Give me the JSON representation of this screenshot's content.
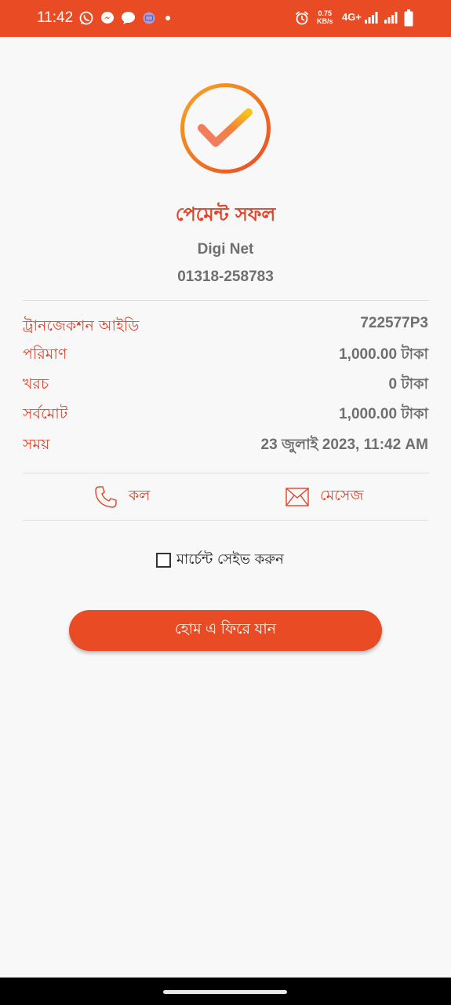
{
  "status_bar": {
    "time": "11:42",
    "net_speed_value": "0.75",
    "net_speed_unit": "KB/s",
    "network_type": "4G+",
    "background_color": "#e94b25",
    "icons": [
      "whatsapp-icon",
      "messenger-icon",
      "chat-icon",
      "app-icon",
      "dot-icon",
      "alarm-icon",
      "signal-icon",
      "signal-icon",
      "battery-icon"
    ]
  },
  "status": {
    "icon": "check-circle-icon",
    "title": "পেমেন্ট সফল"
  },
  "merchant": {
    "name": "Digi Net",
    "number": "01318-258783"
  },
  "details": [
    {
      "label": "ট্রানজেকশন আইডি",
      "value": "722577P3"
    },
    {
      "label": "পরিমাণ",
      "value": "1,000.00 টাকা"
    },
    {
      "label": "খরচ",
      "value": "0 টাকা"
    },
    {
      "label": "সর্বমোট",
      "value": "1,000.00 টাকা"
    },
    {
      "label": "সময়",
      "value": "23 জুলাই 2023, 11:42 AM"
    }
  ],
  "actions": {
    "call_label": "কল",
    "message_label": "মেসেজ"
  },
  "save_merchant": {
    "label": "মার্চেন্ট সেইভ করুন",
    "checked": false
  },
  "home_button": {
    "label": "হোম এ ফিরে যান"
  },
  "colors": {
    "accent": "#e94b25",
    "label_red": "#e2442a",
    "value_gray": "#6f6f6f",
    "check_gradient_start": "#f6a623",
    "check_gradient_end": "#e94b25"
  }
}
